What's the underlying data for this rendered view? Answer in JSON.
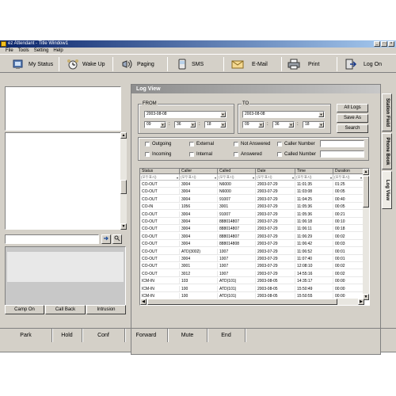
{
  "window": {
    "title": "ez Attendant - Title Window1"
  },
  "title_buttons": [
    "_",
    "□",
    "×"
  ],
  "menu": [
    "File",
    "Tools",
    "Setting",
    "Help"
  ],
  "toolbar": [
    {
      "label": "My Status",
      "icon": "status-icon"
    },
    {
      "label": "Wake Up",
      "icon": "wakeup-icon"
    },
    {
      "label": "Paging",
      "icon": "paging-icon"
    },
    {
      "label": "SMS",
      "icon": "sms-icon"
    },
    {
      "label": "E-Mail",
      "icon": "email-icon"
    },
    {
      "label": "Print",
      "icon": "printer-icon"
    },
    {
      "label": "Log On",
      "icon": "logon-icon"
    }
  ],
  "left_buttons": [
    "Camp On",
    "Call Back",
    "Intrusion"
  ],
  "panel_title": "Log View",
  "from": {
    "label": "FROM",
    "date": "2003-08-08",
    "hour": "09",
    "minute": "36",
    "second": "18"
  },
  "to": {
    "label": "TO",
    "date": "2003-08-08",
    "hour": "09",
    "minute": "36",
    "second": "18"
  },
  "actions": {
    "all_logs": "All Logs",
    "save_as": "Save As",
    "search": "Search"
  },
  "filters": {
    "outgoing": "Outgoing",
    "external": "External",
    "not_answered": "Not Answered",
    "caller_number": "Caller Number",
    "incoming": "Incoming",
    "internal": "Internal",
    "answered": "Answered",
    "called_number": "Called Number"
  },
  "table": {
    "columns": [
      "Status",
      "Caller",
      "Called",
      "Date",
      "Time",
      "Duration"
    ],
    "filter_text": "(모두표시)",
    "rows": [
      [
        "CO-OUT",
        "3004",
        "N6000",
        "2003-07-29",
        "11:01:35",
        "01:25"
      ],
      [
        "CO-OUT",
        "3004",
        "N6000",
        "2003-07-29",
        "11:03:08",
        "00:05"
      ],
      [
        "CO-OUT",
        "3004",
        "91007",
        "2003-07-29",
        "11:04:25",
        "00:40"
      ],
      [
        "CO-IN",
        "1056",
        "3001",
        "2003-07-29",
        "11:05:36",
        "00:05"
      ],
      [
        "CO-OUT",
        "3004",
        "91007",
        "2003-07-29",
        "11:05:36",
        "00:21"
      ],
      [
        "CO-OUT",
        "3004",
        "888014807",
        "2003-07-29",
        "11:06:18",
        "00:10"
      ],
      [
        "CO-OUT",
        "3004",
        "888014807",
        "2003-07-29",
        "11:06:11",
        "00:18"
      ],
      [
        "CO-OUT",
        "3004",
        "888014807",
        "2003-07-29",
        "11:06:29",
        "00:02"
      ],
      [
        "CO-OUT",
        "3004",
        "888014808",
        "2003-07-29",
        "11:06:42",
        "00:03"
      ],
      [
        "CO-OUT",
        "ATD(3002)",
        "1007",
        "2003-07-29",
        "11:06:52",
        "00:01"
      ],
      [
        "CO-OUT",
        "3004",
        "1007",
        "2003-07-29",
        "11:07:40",
        "00:01"
      ],
      [
        "CO-OUT",
        "3001",
        "1007",
        "2003-07-29",
        "12:08:10",
        "00:02"
      ],
      [
        "CO-OUT",
        "3012",
        "1007",
        "2003-07-29",
        "14:55:16",
        "00:02"
      ],
      [
        "ICM-IN",
        "103",
        "ATD(101)",
        "2003-08-05",
        "14:35:17",
        "00:00"
      ],
      [
        "ICM-IN",
        "100",
        "ATD(101)",
        "2003-08-05",
        "15:50:49",
        "00:00"
      ],
      [
        "ICM-IN",
        "100",
        "ATD(101)",
        "2003-08-05",
        "15:50:55",
        "00:00"
      ]
    ]
  },
  "side_tabs": [
    "Station Field",
    "Phone Book",
    "Log View"
  ],
  "status_bar": [
    "Park",
    "Hold",
    "Conf",
    "Forward",
    "Mute",
    "End"
  ]
}
